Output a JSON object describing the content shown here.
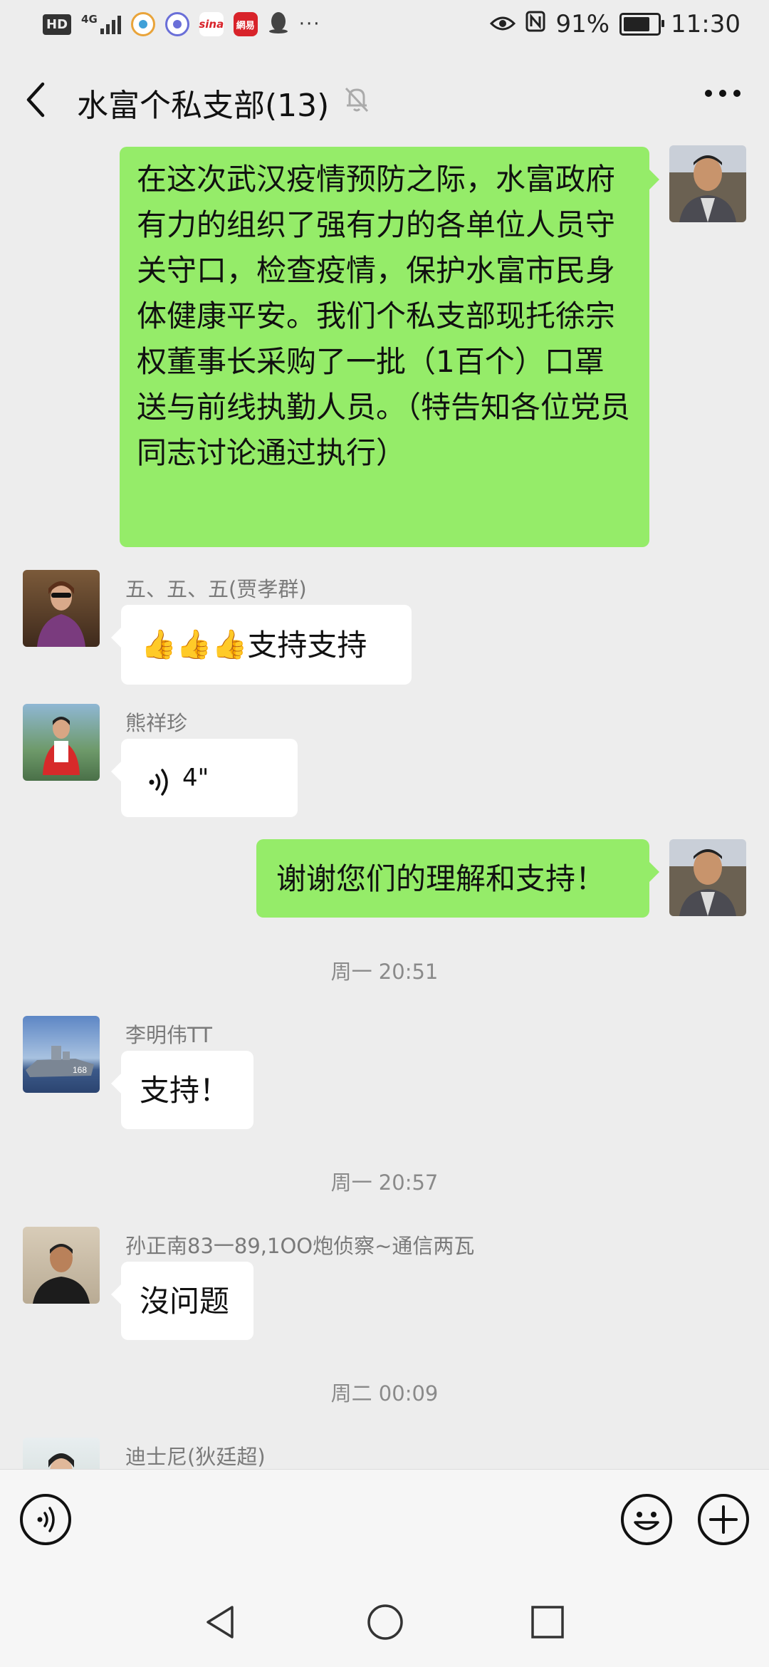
{
  "status_bar": {
    "network_badge": "HD",
    "network_type": "4G",
    "app_icons": [
      "weibo-icon",
      "browser-icon",
      "sina-icon",
      "netease-icon",
      "qq-icon"
    ],
    "sina_text": "sina",
    "netease_text": "網易",
    "more_indicator": "···",
    "battery_percent": "91%",
    "battery_level": 0.91,
    "time": "11:30"
  },
  "header": {
    "title": "水富个私支部(13)",
    "muted": true
  },
  "messages": [
    {
      "type": "text",
      "direction": "out",
      "text": "在这次武汉疫情预防之际，水富政府有力的组织了强有力的各单位人员守关守口，检查疫情，保护水富市民身体健康平安。我们个私支部现托徐宗权董事长采购了一批（1百个）口罩送与前线执勤人员。（特告知各位党员同志讨论通过执行）"
    },
    {
      "type": "text",
      "direction": "in",
      "sender": "五、五、五(贾孝群)",
      "emoji": "👍👍👍",
      "text": "支持支持"
    },
    {
      "type": "voice",
      "direction": "in",
      "sender": "熊祥珍",
      "duration": "4\""
    },
    {
      "type": "text",
      "direction": "out",
      "text": "谢谢您们的理解和支持！"
    },
    {
      "type": "time",
      "text": "周一 20:51"
    },
    {
      "type": "text",
      "direction": "in",
      "sender": "李明伟TT",
      "text": "支持！"
    },
    {
      "type": "time",
      "text": "周一 20:57"
    },
    {
      "type": "text",
      "direction": "in",
      "sender": "孙正南83一89,1OO炮侦察~通信两瓦",
      "text": "沒问题"
    },
    {
      "type": "time",
      "text": "周二 00:09"
    },
    {
      "type": "partial",
      "direction": "in",
      "sender": "迪士尼(狄廷超)"
    }
  ],
  "input_bar": {
    "voice_icon": "voice-mode-icon",
    "emoji_icon": "emoji-icon",
    "plus_icon": "plus-icon"
  },
  "colors": {
    "background": "#ededed",
    "out_bubble": "#95ec69",
    "in_bubble": "#ffffff"
  }
}
